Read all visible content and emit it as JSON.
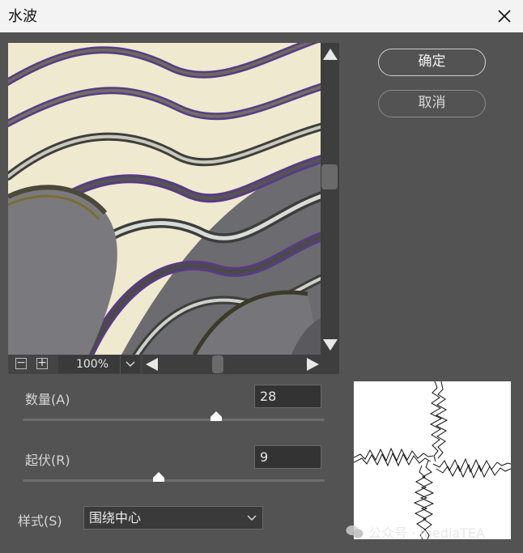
{
  "window": {
    "title": "水波"
  },
  "preview": {
    "zoom": "100%",
    "zoom_minus": "−",
    "zoom_plus": "+"
  },
  "buttons": {
    "ok": "确定",
    "cancel": "取消"
  },
  "params": {
    "amount": {
      "label": "数量(A)",
      "value": "28",
      "fraction": 0.64
    },
    "ridges": {
      "label": "起伏(R)",
      "value": "9",
      "fraction": 0.45
    }
  },
  "style": {
    "label": "样式(S)",
    "selected": "围绕中心"
  },
  "watermark": {
    "text": "公众号 · mediaTEA"
  },
  "colors": {
    "dialog_bg": "#535353",
    "titlebar_bg": "#f3f3f3",
    "preview_cream": "#f2ecd2",
    "preview_purple": "#5b3e86"
  },
  "icons": {
    "close": "close-icon",
    "zoom_dropdown": "chevron-down-icon",
    "scroll_up": "triangle-up-icon",
    "scroll_down": "triangle-down-icon",
    "scroll_left": "triangle-left-icon",
    "scroll_right": "triangle-right-icon",
    "watermark": "wechat-icon"
  }
}
